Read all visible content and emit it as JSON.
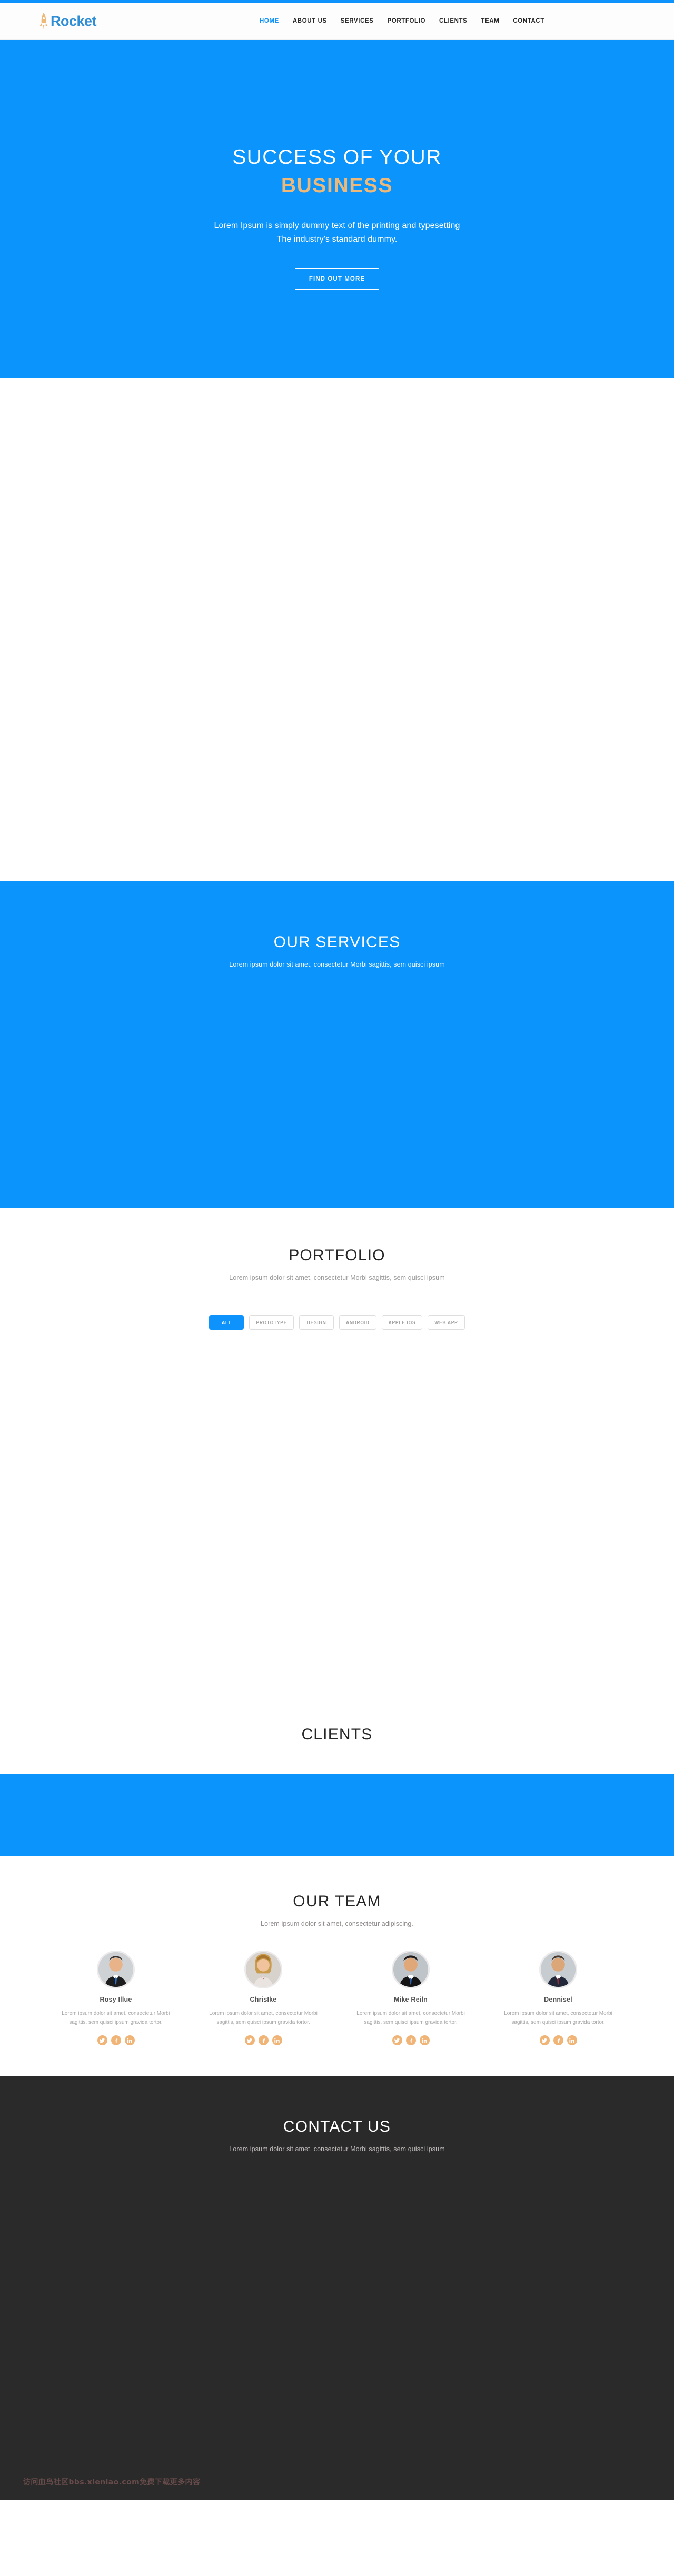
{
  "brand": {
    "logo_text": "Rocket",
    "logo_icon": "rocket-icon",
    "accent_blue": "#0a94fc",
    "accent_orange": "#edb878",
    "dark": "#2b2a2a"
  },
  "nav": {
    "items": [
      {
        "label": "HOME",
        "active": true
      },
      {
        "label": "ABOUT US",
        "active": false
      },
      {
        "label": "SERVICES",
        "active": false
      },
      {
        "label": "PORTFOLIO",
        "active": false
      },
      {
        "label": "CLIENTS",
        "active": false
      },
      {
        "label": "TEAM",
        "active": false
      },
      {
        "label": "CONTACT",
        "active": false
      }
    ]
  },
  "hero": {
    "title_line1": "SUCCESS OF YOUR",
    "title_line2": "BUSINESS",
    "sub_line1": "Lorem Ipsum is simply dummy text of the printing and typesetting",
    "sub_line2": "The industry's standard dummy.",
    "button_label": "FIND OUT MORE"
  },
  "services": {
    "title": "OUR SERVICES",
    "subtitle": "Lorem ipsum dolor sit amet, consectetur Morbi sagittis, sem quisci ipsum"
  },
  "portfolio": {
    "title": "PORTFOLIO",
    "subtitle": "Lorem ipsum dolor sit amet, consectetur Morbi sagittis, sem quisci ipsum",
    "filters": [
      {
        "label": "ALL",
        "active": true
      },
      {
        "label": "PROTOTYPE",
        "active": false
      },
      {
        "label": "DESIGN",
        "active": false
      },
      {
        "label": "ANDROID",
        "active": false
      },
      {
        "label": "APPLE IOS",
        "active": false
      },
      {
        "label": "WEB APP",
        "active": false
      }
    ]
  },
  "clients": {
    "title": "CLIENTS"
  },
  "team": {
    "title": "OUR TEAM",
    "subtitle": "Lorem ipsum dolor sit amet, consectetur adipiscing.",
    "members": [
      {
        "name": "Rosy Illue",
        "desc": "Lorem ipsum dolor sit amet, consectetur Morbi sagittis, sem quisci ipsum gravida tortor.",
        "socials": [
          "twitter-icon",
          "facebook-icon",
          "linkedin-icon"
        ]
      },
      {
        "name": "ChrisIke",
        "desc": "Lorem ipsum dolor sit amet, consectetur Morbi sagittis, sem quisci ipsum gravida tortor.",
        "socials": [
          "twitter-icon",
          "facebook-icon",
          "linkedin-icon"
        ]
      },
      {
        "name": "Mike Reiln",
        "desc": "Lorem ipsum dolor sit amet, consectetur Morbi sagittis, sem quisci ipsum gravida tortor.",
        "socials": [
          "twitter-icon",
          "facebook-icon",
          "linkedin-icon"
        ]
      },
      {
        "name": "Dennisel",
        "desc": "Lorem ipsum dolor sit amet, consectetur Morbi sagittis, sem quisci ipsum gravida tortor.",
        "socials": [
          "twitter-icon",
          "facebook-icon",
          "linkedin-icon"
        ]
      }
    ]
  },
  "contact": {
    "title": "CONTACT US",
    "subtitle": "Lorem ipsum dolor sit amet, consectetur Morbi sagittis, sem quisci ipsum"
  },
  "watermark": {
    "text": "访问血鸟社区bbs.xienlao.com免费下载更多内容"
  }
}
